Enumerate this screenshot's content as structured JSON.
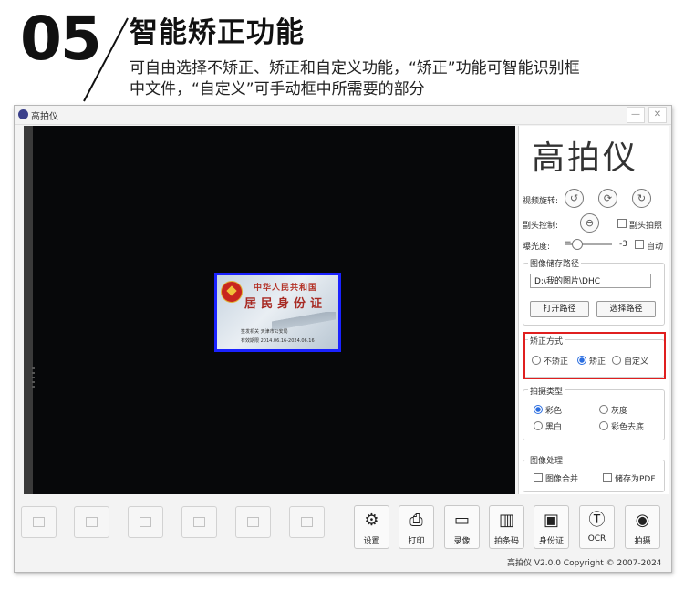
{
  "header": {
    "number": "05",
    "title": "智能矫正功能",
    "desc_line1": "可自由选择不矫正、矫正和自定义功能，“矫正”功能可智能识别框",
    "desc_line2": "中文件，“自定义”可手动框中所需要的部分"
  },
  "window": {
    "title": "高拍仪",
    "minimize": "—",
    "close": "✕"
  },
  "preview": {
    "card_line1": "中华人民共和国",
    "card_line2": "居民身份证",
    "card_line3": "签发机关  天津市公安局",
    "card_line4": "有效期限  2014.06.16-2024.06.16"
  },
  "panel": {
    "brand": "高拍仪",
    "rotate_label": "视频旋转:",
    "rotate_icons": [
      "rotate-left-icon",
      "rotate-reset-icon",
      "rotate-right-icon"
    ],
    "rotate_glyphs": [
      "↺",
      "⟳",
      "↻"
    ],
    "lens_label": "副头控制:",
    "lens_glyph": "⊖",
    "lens_check": "副头拍照",
    "exposure_label": "曝光度:",
    "exposure_minus": "−",
    "exposure_value": "-3",
    "exposure_auto": "自动",
    "path_group": "图像储存路径",
    "path_value": "D:\\我的图片\\DHC",
    "open_path": "打开路径",
    "choose_path": "选择路径",
    "correct_group": "矫正方式",
    "correct_options": [
      "不矫正",
      "矫正",
      "自定义"
    ],
    "correct_selected": "矫正",
    "type_group": "拍摄类型",
    "type_options": [
      "彩色",
      "灰度",
      "黑白",
      "彩色去底"
    ],
    "type_selected": "彩色",
    "process_group": "图像处理",
    "merge": "图像合并",
    "save_pdf": "储存为PDF"
  },
  "toolbar": {
    "tools": [
      {
        "label": "设置",
        "icon": "gear-icon",
        "glyph": "⚙"
      },
      {
        "label": "打印",
        "icon": "printer-icon",
        "glyph": "⎙"
      },
      {
        "label": "录像",
        "icon": "video-camera-icon",
        "glyph": "▭"
      },
      {
        "label": "拍条码",
        "icon": "barcode-icon",
        "glyph": "▥"
      },
      {
        "label": "身份证",
        "icon": "id-card-icon",
        "glyph": "▣"
      },
      {
        "label": "OCR",
        "icon": "ocr-magnifier-icon",
        "glyph": "Ⓣ"
      },
      {
        "label": "拍摄",
        "icon": "camera-icon",
        "glyph": "◉"
      }
    ],
    "copyright": "高拍仪 V2.0.0 Copyright © 2007-2024"
  },
  "colors": {
    "highlight": "#e01f1f",
    "radio_accent": "#2b6ee0",
    "card_border": "#1a22ff"
  }
}
